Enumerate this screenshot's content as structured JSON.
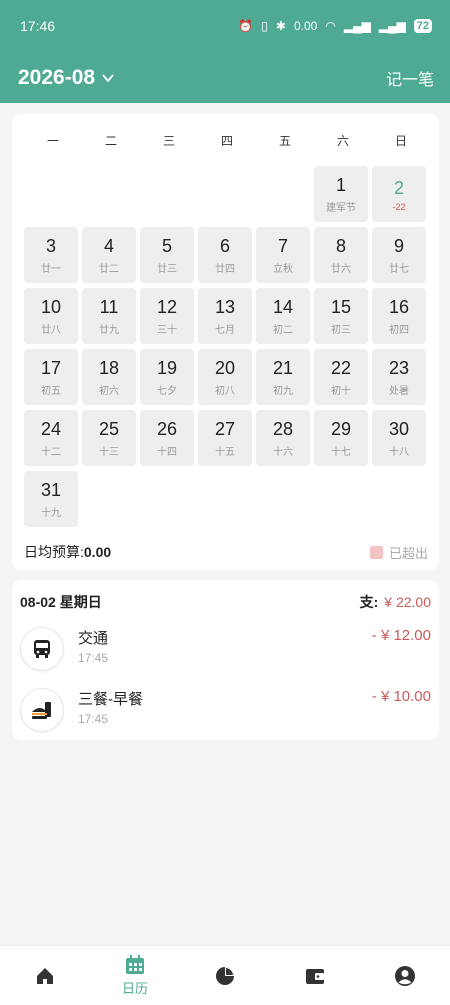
{
  "status_bar": {
    "time": "17:46",
    "network_speed": "0.00",
    "battery": "72"
  },
  "header": {
    "month": "2026-08",
    "record_button": "记一笔"
  },
  "calendar": {
    "weekdays": [
      "一",
      "二",
      "三",
      "四",
      "五",
      "六",
      "日"
    ],
    "leading_blanks": 5,
    "days": [
      {
        "num": "1",
        "sub": "建军节"
      },
      {
        "num": "2",
        "sub": "-22",
        "today": true
      },
      {
        "num": "3",
        "sub": "廿一"
      },
      {
        "num": "4",
        "sub": "廿二"
      },
      {
        "num": "5",
        "sub": "廿三"
      },
      {
        "num": "6",
        "sub": "廿四"
      },
      {
        "num": "7",
        "sub": "立秋"
      },
      {
        "num": "8",
        "sub": "廿六"
      },
      {
        "num": "9",
        "sub": "廿七"
      },
      {
        "num": "10",
        "sub": "廿八"
      },
      {
        "num": "11",
        "sub": "廿九"
      },
      {
        "num": "12",
        "sub": "三十"
      },
      {
        "num": "13",
        "sub": "七月"
      },
      {
        "num": "14",
        "sub": "初二"
      },
      {
        "num": "15",
        "sub": "初三"
      },
      {
        "num": "16",
        "sub": "初四"
      },
      {
        "num": "17",
        "sub": "初五"
      },
      {
        "num": "18",
        "sub": "初六"
      },
      {
        "num": "19",
        "sub": "七夕"
      },
      {
        "num": "20",
        "sub": "初八"
      },
      {
        "num": "21",
        "sub": "初九"
      },
      {
        "num": "22",
        "sub": "初十"
      },
      {
        "num": "23",
        "sub": "处暑"
      },
      {
        "num": "24",
        "sub": "十二"
      },
      {
        "num": "25",
        "sub": "十三"
      },
      {
        "num": "26",
        "sub": "十四"
      },
      {
        "num": "27",
        "sub": "十五"
      },
      {
        "num": "28",
        "sub": "十六"
      },
      {
        "num": "29",
        "sub": "十七"
      },
      {
        "num": "30",
        "sub": "十八"
      },
      {
        "num": "31",
        "sub": "十九"
      }
    ],
    "budget_label": "日均预算:",
    "budget_value": "0.00",
    "legend_label": "已超出"
  },
  "detail": {
    "date": "08-02 星期日",
    "total_label": "支:",
    "total_amount": "¥ 22.00",
    "entries": [
      {
        "name": "交通",
        "time": "17:45",
        "amount": "- ¥ 12.00",
        "icon": "bus-icon"
      },
      {
        "name": "三餐-早餐",
        "time": "17:45",
        "amount": "- ¥ 10.00",
        "icon": "breakfast-icon"
      }
    ]
  },
  "tabbar": {
    "calendar_label": "日历"
  },
  "colors": {
    "accent": "#4eaa92",
    "expense": "#c85b5b",
    "over_budget": "#f4c4c4"
  }
}
